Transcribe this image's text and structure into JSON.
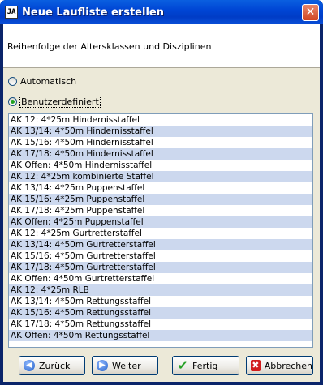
{
  "window": {
    "title": "Neue Laufliste erstellen",
    "app_icon_text": "JA"
  },
  "header": {
    "text": "Reihenfolge der Altersklassen und Disziplinen"
  },
  "options": {
    "automatic_label": "Automatisch",
    "custom_label": "Benutzerdefiniert",
    "selected": "custom"
  },
  "list": {
    "items": [
      "AK 12: 4*25m Hindernisstaffel",
      "AK 13/14: 4*50m Hindernisstaffel",
      "AK 15/16: 4*50m Hindernisstaffel",
      "AK 17/18: 4*50m Hindernisstaffel",
      "AK Offen: 4*50m Hindernisstaffel",
      "AK 12: 4*25m kombinierte Staffel",
      "AK 13/14: 4*25m Puppenstaffel",
      "AK 15/16: 4*25m Puppenstaffel",
      "AK 17/18: 4*25m Puppenstaffel",
      "AK Offen: 4*25m Puppenstaffel",
      "AK 12: 4*25m Gurtretterstaffel",
      "AK 13/14: 4*50m Gurtretterstaffel",
      "AK 15/16: 4*50m Gurtretterstaffel",
      "AK 17/18: 4*50m Gurtretterstaffel",
      "AK Offen: 4*50m Gurtretterstaffel",
      "AK 12: 4*25m RLB",
      "AK 13/14: 4*50m Rettungsstaffel",
      "AK 15/16: 4*50m Rettungsstaffel",
      "AK 17/18: 4*50m Rettungsstaffel",
      "AK Offen: 4*50m Rettungsstaffel"
    ]
  },
  "buttons": {
    "back_label": "Zurück",
    "next_label": "Weiter",
    "finish_label": "Fertig",
    "cancel_label": "Abbrechen"
  },
  "icons": {
    "back": "arrow-left-icon",
    "next": "arrow-right-icon",
    "finish": "checkmark-icon",
    "cancel": "cross-icon",
    "close": "close-icon"
  },
  "colors": {
    "titlebar": "#0046d5",
    "row_alt": "#ccd8ee",
    "dialog_bg": "#ece9d8"
  }
}
